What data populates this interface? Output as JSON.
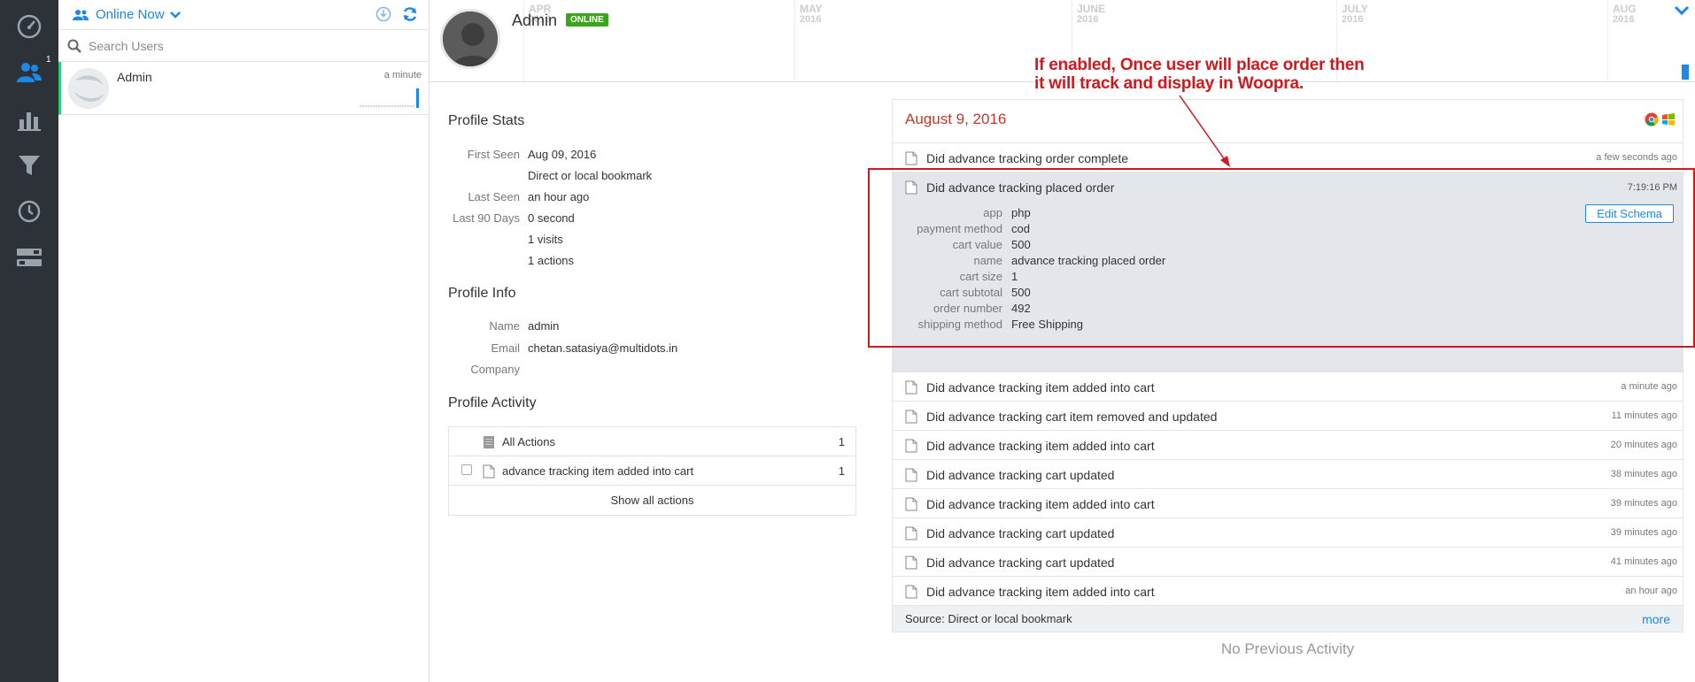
{
  "nav": {
    "users_badge": "1",
    "items": [
      "dashboard-icon",
      "people-icon",
      "bar-chart-icon",
      "funnel-icon",
      "history-icon",
      "toggle-icon"
    ]
  },
  "users_panel": {
    "filter_label": "Online Now",
    "search_placeholder": "Search Users",
    "users": [
      {
        "name": "Admin",
        "last_seen": "a minute"
      }
    ]
  },
  "profile": {
    "name": "Admin",
    "status": "ONLINE"
  },
  "timeline": {
    "months": [
      {
        "name": "APR",
        "year": "2016"
      },
      {
        "name": "MAY",
        "year": "2016"
      },
      {
        "name": "JUNE",
        "year": "2016"
      },
      {
        "name": "JULY",
        "year": "2016"
      },
      {
        "name": "AUG",
        "year": "2016"
      }
    ]
  },
  "profile_stats": {
    "title": "Profile Stats",
    "first_seen_label": "First Seen",
    "first_seen": "Aug 09, 2016",
    "first_seen_source": "Direct or local bookmark",
    "last_seen_label": "Last Seen",
    "last_seen": "an hour ago",
    "last90_label": "Last 90 Days",
    "last90_time": "0 second",
    "visits": "1 visits",
    "actions": "1 actions"
  },
  "profile_info": {
    "title": "Profile Info",
    "name_label": "Name",
    "name": "admin",
    "email_label": "Email",
    "email": "chetan.satasiya@multidots.in",
    "company_label": "Company",
    "company": ""
  },
  "profile_activity": {
    "title": "Profile Activity",
    "rows": [
      {
        "label": "All Actions",
        "count": "1"
      },
      {
        "label": "advance tracking item added into cart",
        "count": "1"
      }
    ],
    "show_all": "Show all actions"
  },
  "feed": {
    "date": "August 9, 2016",
    "first": {
      "title": "Did advance tracking order complete",
      "time": "a few seconds ago"
    },
    "expanded": {
      "title": "Did advance tracking placed order",
      "time": "7:19:16 PM",
      "edit_label": "Edit Schema",
      "props": [
        {
          "k": "app",
          "v": "php"
        },
        {
          "k": "payment method",
          "v": "cod"
        },
        {
          "k": "cart value",
          "v": "500"
        },
        {
          "k": "name",
          "v": "advance tracking placed order"
        },
        {
          "k": "cart size",
          "v": "1"
        },
        {
          "k": "cart subtotal",
          "v": "500"
        },
        {
          "k": "order number",
          "v": "492"
        },
        {
          "k": "shipping method",
          "v": "Free Shipping"
        }
      ]
    },
    "rows": [
      {
        "title": "Did advance tracking item added into cart",
        "time": "a minute ago"
      },
      {
        "title": "Did advance tracking cart item removed and updated",
        "time": "11 minutes ago"
      },
      {
        "title": "Did advance tracking item added into cart",
        "time": "20 minutes ago"
      },
      {
        "title": "Did advance tracking cart updated",
        "time": "38 minutes ago"
      },
      {
        "title": "Did advance tracking item added into cart",
        "time": "39 minutes ago"
      },
      {
        "title": "Did advance tracking cart updated",
        "time": "39 minutes ago"
      },
      {
        "title": "Did advance tracking cart updated",
        "time": "41 minutes ago"
      },
      {
        "title": "Did advance tracking item added into cart",
        "time": "an hour ago"
      }
    ],
    "source": "Source: Direct or local bookmark",
    "more": "more"
  },
  "no_previous": "No Previous Activity",
  "annotation": {
    "line1": "If enabled, Once user will place order then",
    "line2": "it will track and display in Woopra."
  },
  "colors": {
    "nav_bg": "#2c3238",
    "accent": "#1e88e5",
    "online": "#3aa61e",
    "date_red": "#c0392b",
    "annotation_red": "#d0191e",
    "expanded_bg": "#e3e7ec"
  }
}
